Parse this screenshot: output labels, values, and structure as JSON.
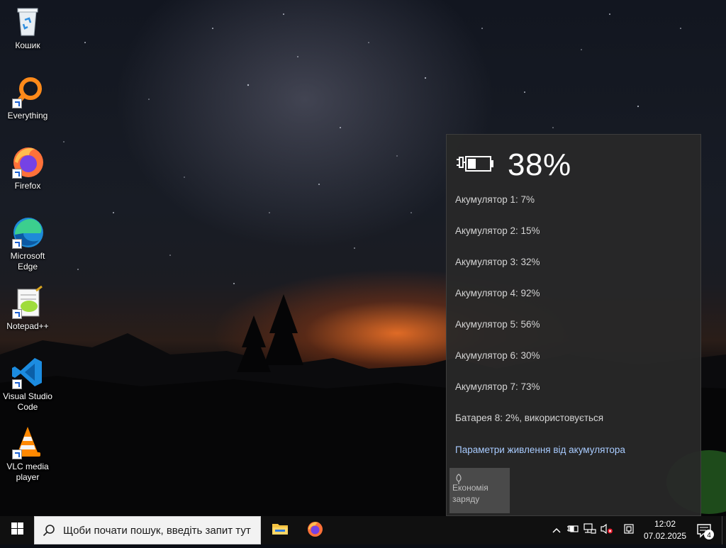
{
  "desktop": {
    "icons": [
      {
        "label": "Кошик",
        "icon": "recycle-bin-icon"
      },
      {
        "label": "Everything",
        "icon": "everything-search-icon"
      },
      {
        "label": "Firefox",
        "icon": "firefox-icon"
      },
      {
        "label": "Microsoft Edge",
        "icon": "edge-icon"
      },
      {
        "label": "Notepad++",
        "icon": "notepad-plus-plus-icon"
      },
      {
        "label": "Visual Studio Code",
        "icon": "vscode-icon"
      },
      {
        "label": "VLC media player",
        "icon": "vlc-icon"
      }
    ]
  },
  "battery_flyout": {
    "percent_text": "38%",
    "charge_level": 0.38,
    "batteries": [
      "Акумулятор 1: 7%",
      "Акумулятор 2: 15%",
      "Акумулятор 3: 32%",
      "Акумулятор 4: 92%",
      "Акумулятор 5: 56%",
      "Акумулятор 6: 30%",
      "Акумулятор 7: 73%",
      "Батарея 8: 2%, використовується"
    ],
    "settings_link": "Параметри живлення від акумулятора",
    "saver_label": "Економія заряду"
  },
  "taskbar": {
    "search_placeholder": "Щоби почати пошук, введіть запит тут",
    "apps": [
      "file-explorer-icon",
      "firefox-icon"
    ],
    "tray": [
      "chevron-up-icon",
      "battery-icon",
      "network-icon",
      "volume-muted-icon",
      "keyboard-layout-icon"
    ],
    "time": "12:02",
    "date": "07.02.2025",
    "notification_count": "4"
  },
  "colors": {
    "flyout_bg": "#282828",
    "link": "#a8cbff",
    "taskbar": "#101010",
    "accent_orange": "#ff7a28"
  }
}
